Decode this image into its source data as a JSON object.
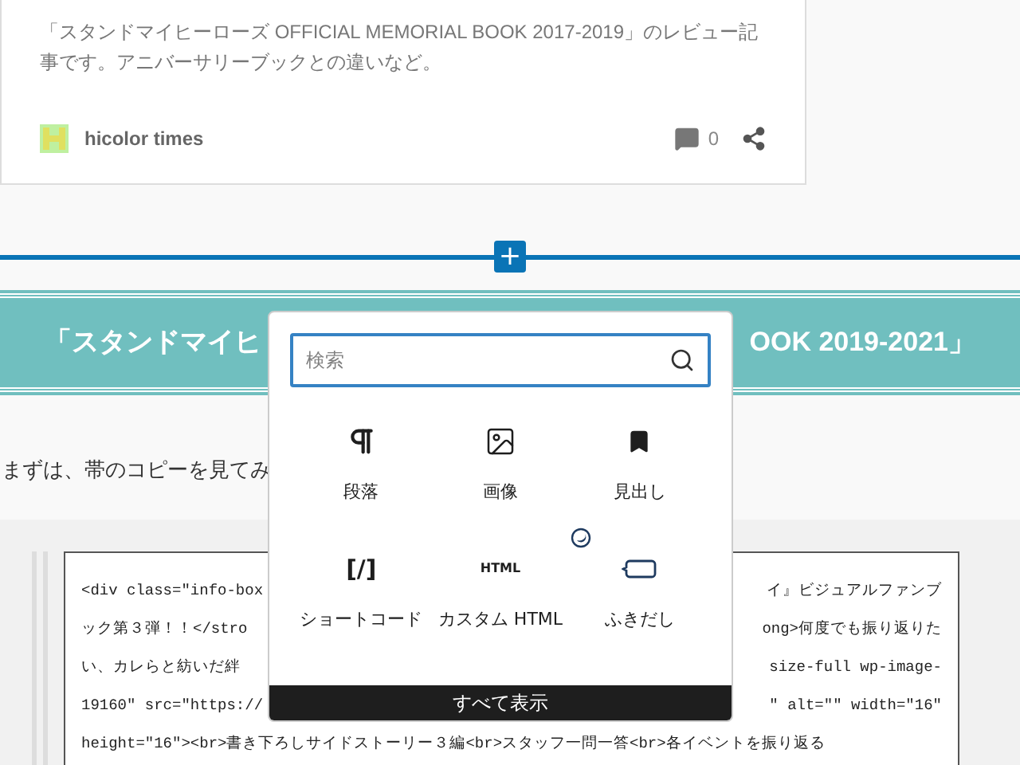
{
  "post_card": {
    "excerpt": "「スタンドマイヒーローズ OFFICIAL MEMORIAL BOOK 2017-2019」のレビュー記事です。アニバーサリーブックとの違いなど。",
    "site_name": "hicolor times",
    "comment_count": "0"
  },
  "inserter_line": {
    "button": "+"
  },
  "heading": {
    "left": "「スタンドマイヒ",
    "right": "OOK 2019-2021」"
  },
  "paragraph": "まずは、帯のコピーを見てみ",
  "code_block": {
    "lines": [
      {
        "left": "<div class=\"info-box",
        "right": "イ』ビジュアルファンブ"
      },
      {
        "left": "ック第３弾！！</stro",
        "right": "ong>何度でも振り返りた"
      },
      {
        "left": "い、カレらと紡いだ絆",
        "right": "size-full wp-image-"
      },
      {
        "left": "19160\" src=\"https://",
        "right": "\" alt=\"\" width=\"16\""
      },
      {
        "left": "height=\"16\"><br>書き下ろしサイドストーリー３編<br>スタッフ一問一答<br>各イベントを振り返る"
      }
    ]
  },
  "inserter": {
    "search": {
      "placeholder": "検索"
    },
    "blocks": [
      {
        "kind": "paragraph",
        "label": "段落"
      },
      {
        "kind": "image",
        "label": "画像"
      },
      {
        "kind": "heading",
        "label": "見出し"
      },
      {
        "kind": "glyph",
        "glyph": "[/]",
        "label": "ショートコード"
      },
      {
        "kind": "glyph_small",
        "glyph": "HTML",
        "label": "カスタム HTML"
      },
      {
        "kind": "balloon",
        "label": "ふきだし",
        "badge": true
      }
    ],
    "show_all": "すべて表示"
  }
}
